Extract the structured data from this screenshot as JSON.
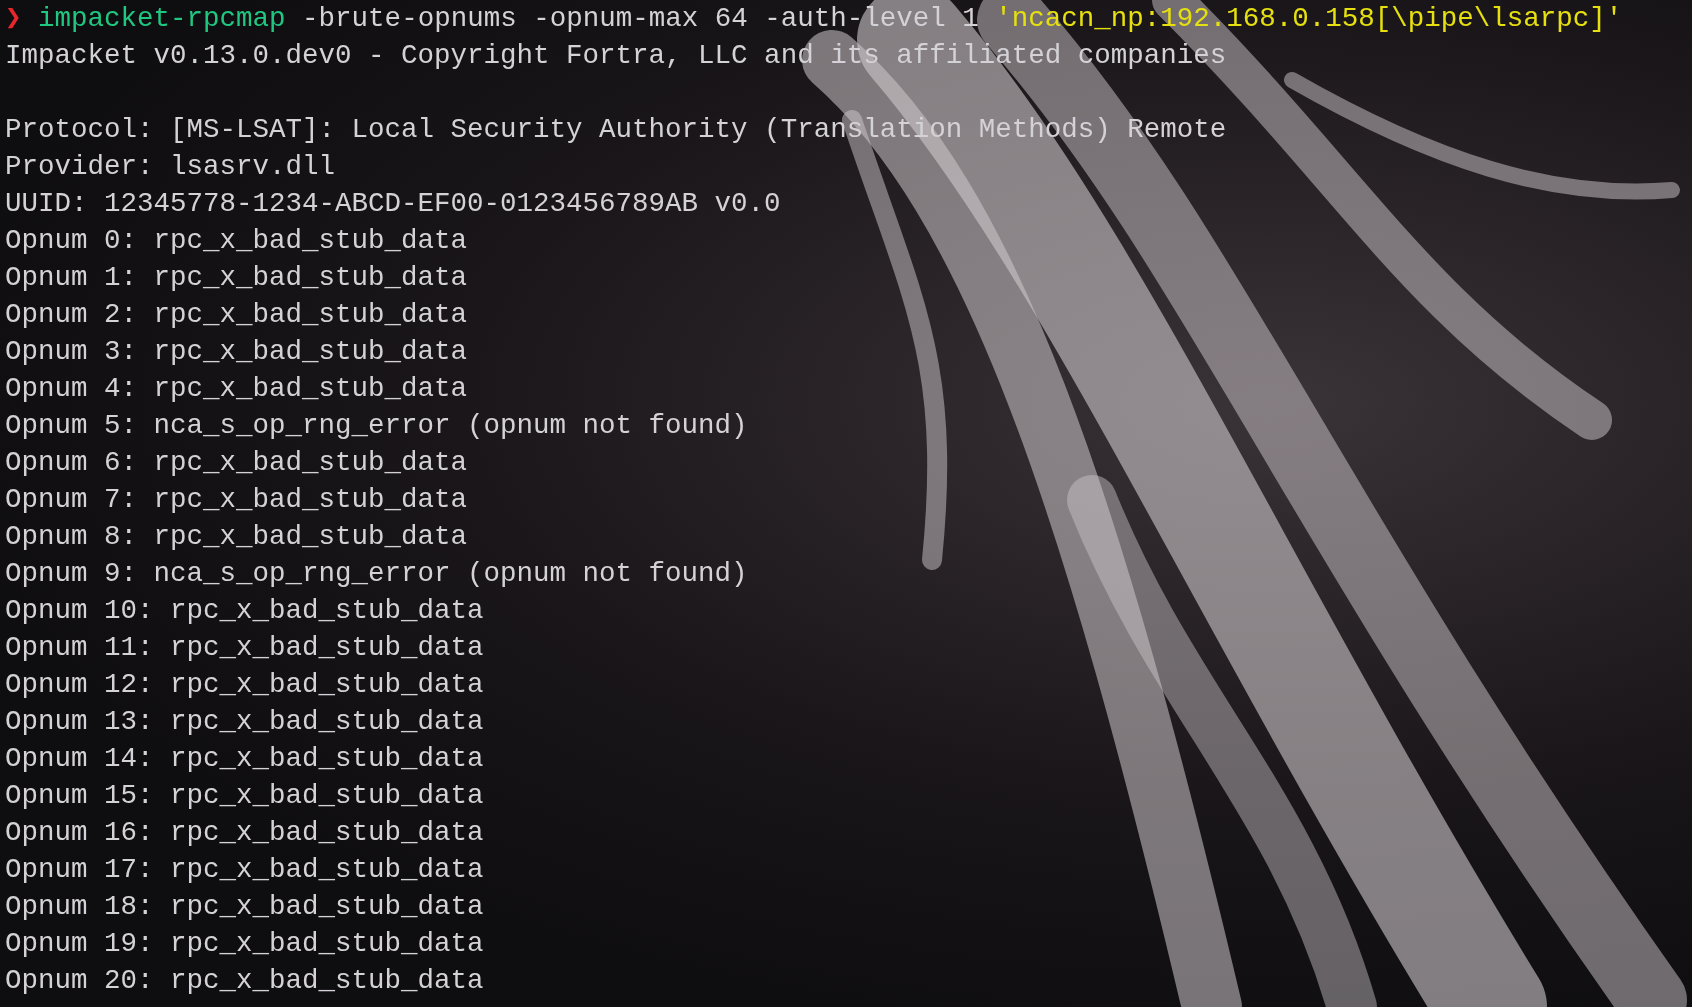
{
  "prompt": {
    "symbol": "❯",
    "command": "impacket-rpcmap",
    "args": "-brute-opnums -opnum-max 64 -auth-level 1",
    "target": "'ncacn_np:192.168.0.158[\\pipe\\lsarpc]'"
  },
  "banner": "Impacket v0.13.0.dev0 - Copyright Fortra, LLC and its affiliated companies",
  "output_lines": [
    "Protocol: [MS-LSAT]: Local Security Authority (Translation Methods) Remote",
    "Provider: lsasrv.dll",
    "UUID: 12345778-1234-ABCD-EF00-0123456789AB v0.0",
    "Opnum 0: rpc_x_bad_stub_data",
    "Opnum 1: rpc_x_bad_stub_data",
    "Opnum 2: rpc_x_bad_stub_data",
    "Opnum 3: rpc_x_bad_stub_data",
    "Opnum 4: rpc_x_bad_stub_data",
    "Opnum 5: nca_s_op_rng_error (opnum not found)",
    "Opnum 6: rpc_x_bad_stub_data",
    "Opnum 7: rpc_x_bad_stub_data",
    "Opnum 8: rpc_x_bad_stub_data",
    "Opnum 9: nca_s_op_rng_error (opnum not found)",
    "Opnum 10: rpc_x_bad_stub_data",
    "Opnum 11: rpc_x_bad_stub_data",
    "Opnum 12: rpc_x_bad_stub_data",
    "Opnum 13: rpc_x_bad_stub_data",
    "Opnum 14: rpc_x_bad_stub_data",
    "Opnum 15: rpc_x_bad_stub_data",
    "Opnum 16: rpc_x_bad_stub_data",
    "Opnum 17: rpc_x_bad_stub_data",
    "Opnum 18: rpc_x_bad_stub_data",
    "Opnum 19: rpc_x_bad_stub_data",
    "Opnum 20: rpc_x_bad_stub_data"
  ]
}
